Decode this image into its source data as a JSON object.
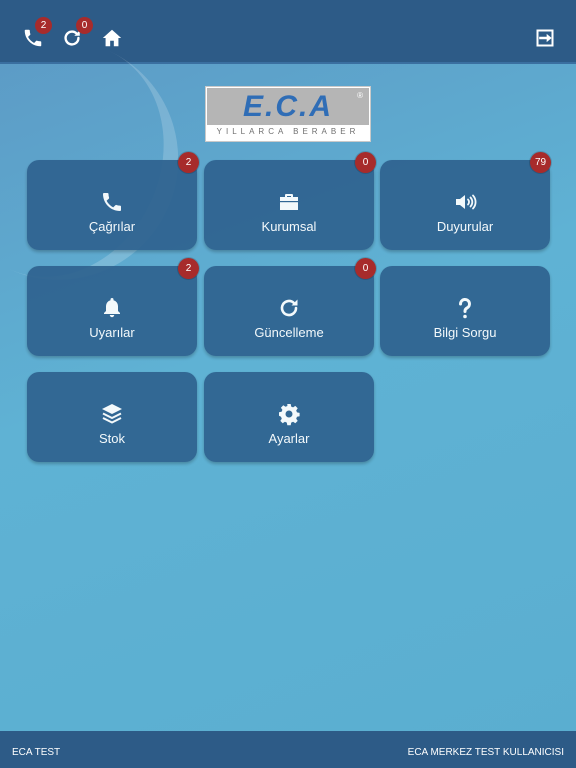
{
  "topbar": {
    "calls_badge": "2",
    "updates_badge": "0",
    "icons": [
      "phone-icon",
      "refresh-icon",
      "home-icon",
      "logout-icon"
    ]
  },
  "logo": {
    "main": "E.C.A",
    "sub": "YILLARCA BERABER",
    "reg": "®"
  },
  "tiles": [
    {
      "label": "Çağrılar",
      "badge": "2",
      "icon": "phone-icon"
    },
    {
      "label": "Kurumsal",
      "badge": "0",
      "icon": "briefcase-icon"
    },
    {
      "label": "Duyurular",
      "badge": "79",
      "icon": "volume-icon"
    },
    {
      "label": "Uyarılar",
      "badge": "2",
      "icon": "bell-icon"
    },
    {
      "label": "Güncelleme",
      "badge": "0",
      "icon": "refresh-icon"
    },
    {
      "label": "Bilgi Sorgu",
      "icon": "question-icon"
    },
    {
      "label": "Stok",
      "icon": "layers-icon"
    },
    {
      "label": "Ayarlar",
      "icon": "gear-icon"
    }
  ],
  "footer": {
    "left": "ECA TEST",
    "right": "ECA MERKEZ TEST KULLANICISI"
  },
  "colors": {
    "header": "#2d5b87",
    "tile": "#2f6390",
    "badge": "#a72b2b",
    "logo_blue": "#2f6db6"
  }
}
